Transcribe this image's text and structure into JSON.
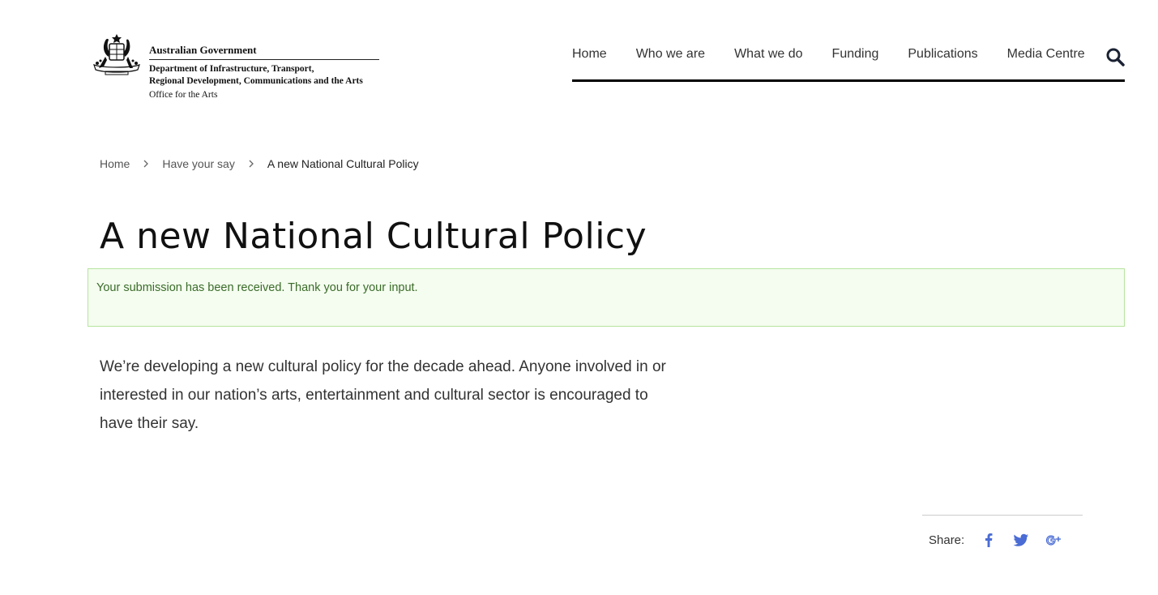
{
  "header": {
    "gov_name": "Australian Government",
    "dept_line_1": "Department of Infrastructure, Transport,",
    "dept_line_2": "Regional Development, Communications and the Arts",
    "office": "Office for the Arts"
  },
  "nav": {
    "items": [
      {
        "label": "Home"
      },
      {
        "label": "Who we are"
      },
      {
        "label": "What we do"
      },
      {
        "label": "Funding"
      },
      {
        "label": "Publications"
      },
      {
        "label": "Media Centre"
      }
    ],
    "search_icon": "search-icon"
  },
  "breadcrumb": {
    "items": [
      {
        "label": "Home"
      },
      {
        "label": "Have your say"
      },
      {
        "label": "A new National Cultural Policy"
      }
    ]
  },
  "page": {
    "title": "A new National Cultural Policy",
    "message": "Your submission has been received.  Thank you for your input.",
    "intro": "We’re developing a new cultural policy for the decade ahead. Anyone involved in or interested in our nation’s arts, entertainment and cultural sector is encouraged to have their say."
  },
  "share": {
    "label": "Share:",
    "icons": [
      "facebook-icon",
      "twitter-icon",
      "google-plus-icon"
    ]
  },
  "colors": {
    "share_icon": "#4a6cd4",
    "message_bg": "#f4fdef",
    "message_border": "#b8e3a0",
    "message_text": "#3b6b2a",
    "nav_underline": "#000000"
  }
}
